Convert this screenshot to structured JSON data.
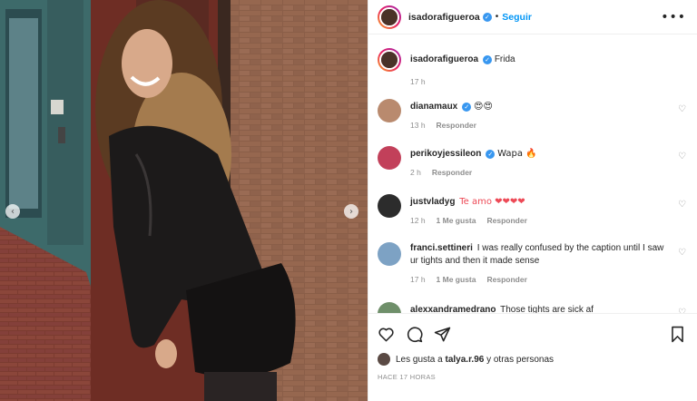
{
  "post": {
    "author": "isadorafigueroa",
    "follow_label": "Seguir",
    "caption": "Frida",
    "caption_time": "17 h",
    "separator": "•"
  },
  "comments": [
    {
      "user": "dianamaux",
      "text": "😍😍",
      "time": "13 h",
      "likes": "",
      "reply": "Responder",
      "verified": true,
      "avatar_color": "#b98a6e"
    },
    {
      "user": "perikoyjessileon",
      "text": "Wapa 🔥",
      "time": "2 h",
      "likes": "",
      "reply": "Responder",
      "verified": true,
      "avatar_color": "#c2405a"
    },
    {
      "user": "justvladyg",
      "text": "Te amo ❤❤❤❤",
      "time": "12 h",
      "likes": "1 Me gusta",
      "reply": "Responder",
      "verified": false,
      "avatar_color": "#2c2c2c"
    },
    {
      "user": "franci.settineri",
      "text": "I was really confused by the caption until I saw ur tights and then it made sense",
      "time": "17 h",
      "likes": "1 Me gusta",
      "reply": "Responder",
      "verified": false,
      "avatar_color": "#7da2c4"
    },
    {
      "user": "alexxandramedrano",
      "text": "Those tights are sick af",
      "time": "",
      "likes": "",
      "reply": "",
      "verified": false,
      "avatar_color": "#6f8f6a"
    }
  ],
  "likes": {
    "prefix": "Les gusta a",
    "user": "talya.r.96",
    "suffix": "y otras personas"
  },
  "timestamp": "HACE 17 HORAS",
  "colors": {
    "accent": "#0095f6",
    "verified": "#3897f0",
    "heart": "#ed4956"
  },
  "icons": [
    "heart-icon",
    "comment-icon",
    "share-icon",
    "bookmark-icon",
    "more-icon",
    "chevron-left-icon",
    "chevron-right-icon"
  ]
}
